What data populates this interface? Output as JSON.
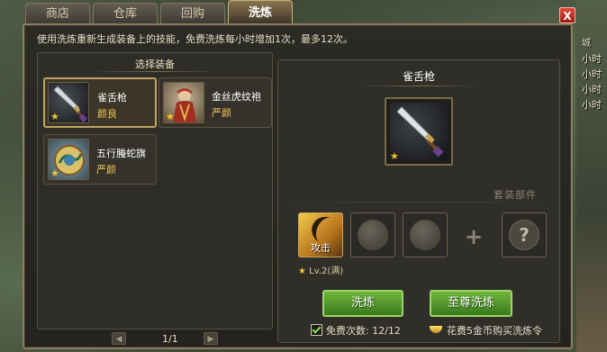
{
  "tabs": [
    {
      "label": "商店"
    },
    {
      "label": "仓库"
    },
    {
      "label": "回购"
    },
    {
      "label": "洗炼"
    }
  ],
  "close_label": "X",
  "side_labels": [
    "城",
    "小时",
    "小时",
    "小时",
    "小时"
  ],
  "info_text": "使用洗炼重新生成装备上的技能，免费洗炼每小时增加1次，最多12次。",
  "selection": {
    "title": "选择装备",
    "items": [
      {
        "name": "雀舌枪",
        "quality": "颜良",
        "selected": true
      },
      {
        "name": "金丝虎纹袍",
        "quality": "严颜",
        "selected": false
      },
      {
        "name": "五行螣蛇旗",
        "quality": "严颜",
        "selected": false
      }
    ],
    "page": "1/1"
  },
  "detail": {
    "title": "雀舌枪",
    "set_label": "套装部件",
    "skills": [
      {
        "label": "攻击"
      }
    ],
    "unknown_mark": "?",
    "level": "Lv.2(满)",
    "wash_button": "洗炼",
    "supreme_button": "至尊洗炼",
    "free_count": "免费次数: 12/12",
    "buy_text": "花费5金币购买洗炼令"
  },
  "colors": {
    "accent_green": "#6fb53a",
    "gold": "#f4c32a",
    "quality_yellow": "#f0c55a"
  }
}
